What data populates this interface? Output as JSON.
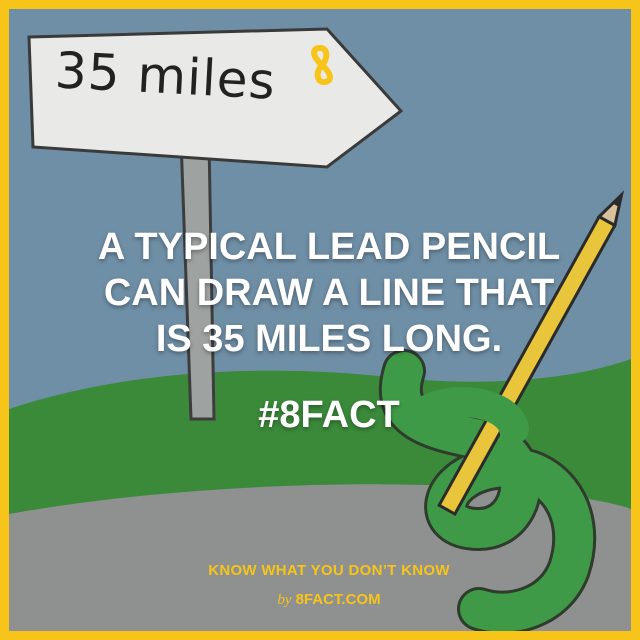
{
  "sign": {
    "text": "35 miles"
  },
  "fact": {
    "lines": [
      "A TYPICAL LEAD PENCIL",
      "CAN DRAW A LINE THAT",
      "IS 35 MILES LONG."
    ],
    "hashtag": "#8FACT"
  },
  "footer": {
    "tagline": "KNOW WHAT YOU DON’T KNOW",
    "by": "by",
    "site": "8FACT.COM"
  },
  "colors": {
    "frame": "#f7c51a",
    "sky": "#6f8fa6",
    "grass": "#3b8a3a",
    "road": "#8f9090",
    "snake": "#3f9a47",
    "pencil": "#e8c53a"
  },
  "icons": [
    "infinity-eight-logo-icon"
  ]
}
